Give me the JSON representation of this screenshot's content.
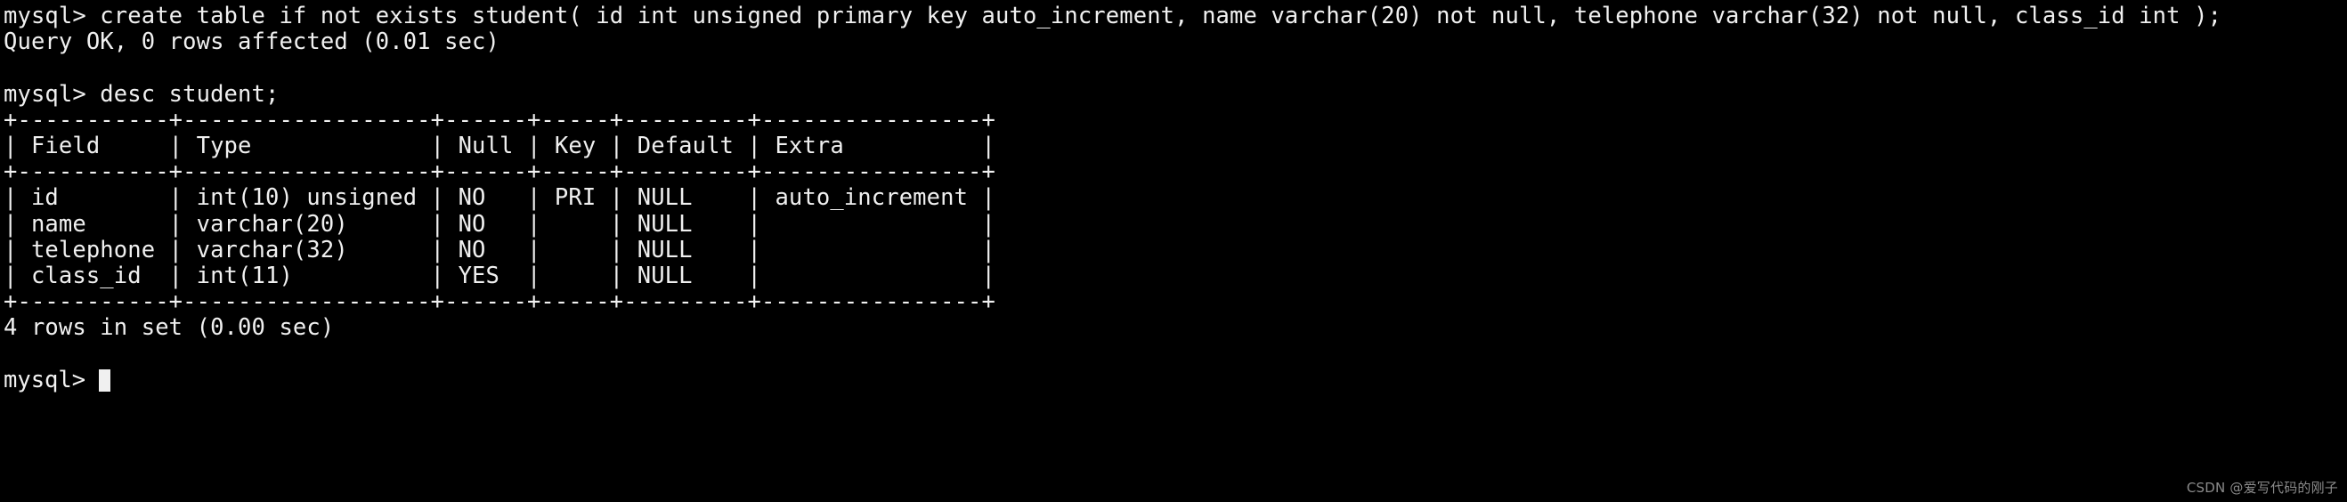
{
  "terminal": {
    "background_color": "#000000",
    "foreground_color": "#f0f0f0",
    "cursor_color": "#f0f0f0",
    "prompt": "mysql>",
    "lines": [
      "mysql> create table if not exists student( id int unsigned primary key auto_increment, name varchar(20) not null, telephone varchar(32) not null, class_id int );",
      "Query OK, 0 rows affected (0.01 sec)",
      "",
      "mysql> desc student;",
      "+-----------+------------------+------+-----+---------+----------------+",
      "| Field     | Type             | Null | Key | Default | Extra          |",
      "+-----------+------------------+------+-----+---------+----------------+",
      "| id        | int(10) unsigned | NO   | PRI | NULL    | auto_increment |",
      "| name      | varchar(20)      | NO   |     | NULL    |                |",
      "| telephone | varchar(32)      | NO   |     | NULL    |                |",
      "| class_id  | int(11)          | YES  |     | NULL    |                |",
      "+-----------+------------------+------+-----+---------+----------------+",
      "4 rows in set (0.00 sec)",
      ""
    ],
    "commands": [
      "create table if not exists student( id int unsigned primary key auto_increment, name varchar(20) not null, telephone varchar(32) not null, class_id int );",
      "desc student;"
    ],
    "results": {
      "create_status": "Query OK, 0 rows affected (0.01 sec)",
      "describe_footer": "4 rows in set (0.00 sec)"
    },
    "describe_table": {
      "headers": [
        "Field",
        "Type",
        "Null",
        "Key",
        "Default",
        "Extra"
      ],
      "rows": [
        [
          "id",
          "int(10) unsigned",
          "NO",
          "PRI",
          "NULL",
          "auto_increment"
        ],
        [
          "name",
          "varchar(20)",
          "NO",
          "",
          "NULL",
          ""
        ],
        [
          "telephone",
          "varchar(32)",
          "NO",
          "",
          "NULL",
          ""
        ],
        [
          "class_id",
          "int(11)",
          "YES",
          "",
          "NULL",
          ""
        ]
      ]
    },
    "current_prompt": "mysql>"
  },
  "watermark": {
    "text": "CSDN @爱写代码的刚子"
  }
}
